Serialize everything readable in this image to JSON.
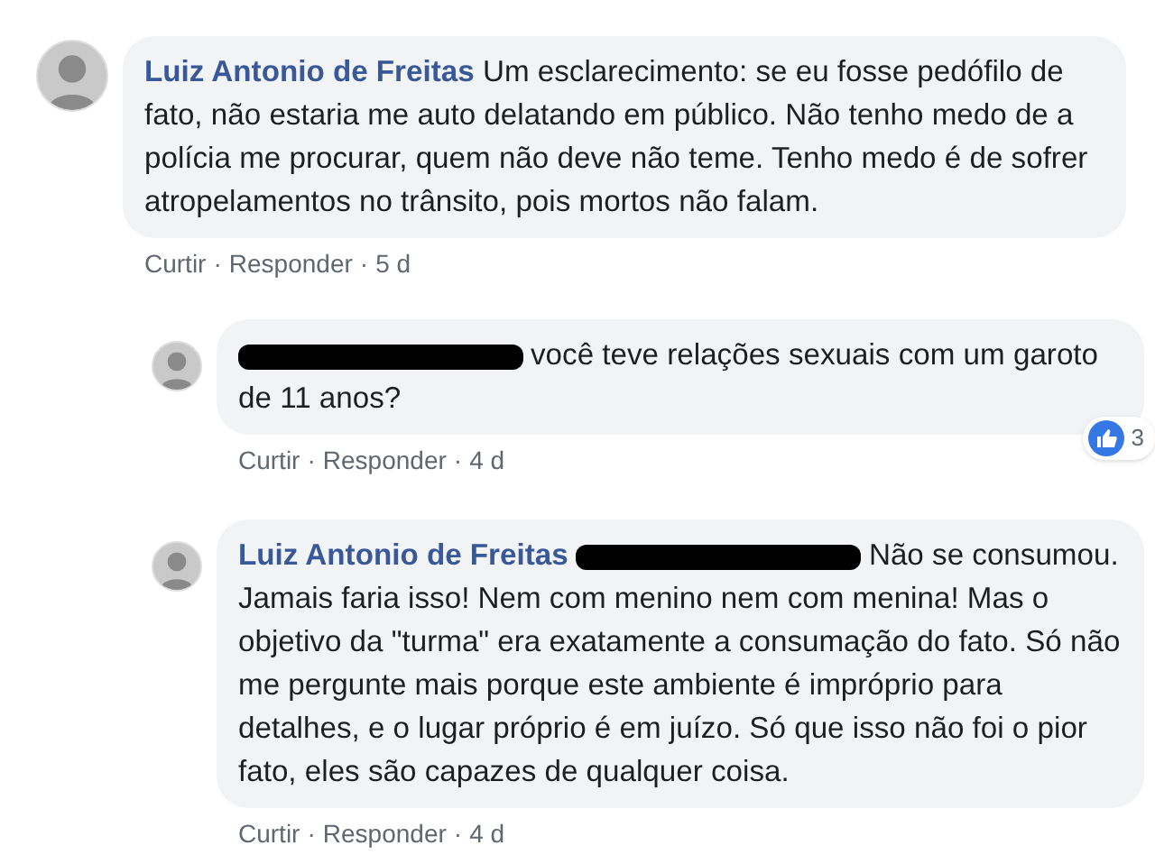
{
  "comment": {
    "author": "Luiz Antonio de Freitas",
    "text": "Um esclarecimento: se eu fosse pedófilo de fato, não estaria me auto delatando em público. Não tenho medo de a polícia me procurar, quem não deve não teme. Tenho medo é de sofrer atropelamentos no trânsito, pois mortos não falam.",
    "actions": [
      "Curtir",
      "Responder"
    ],
    "separator": "·",
    "time": "5 d",
    "replies": [
      {
        "redacted": true,
        "text": "você teve relações sexuais com um garoto de 11 anos?",
        "actions": [
          "Curtir",
          "Responder"
        ],
        "separator": "·",
        "time": "4 d",
        "reactions": "3"
      },
      {
        "author": "Luiz Antonio de Freitas",
        "redacted": true,
        "text": "Não se consumou. Jamais faria isso! Nem com menino nem com menina! Mas o objetivo da \"turma\" era exatamente a consumação do fato. Só não me pergunte mais porque este ambiente é impróprio para detalhes, e o lugar próprio é em juízo. Só que isso não foi o pior fato, eles são capazes de qualquer coisa.",
        "actions": [
          "Curtir",
          "Responder"
        ],
        "separator": "·",
        "time": "4 d"
      }
    ]
  }
}
